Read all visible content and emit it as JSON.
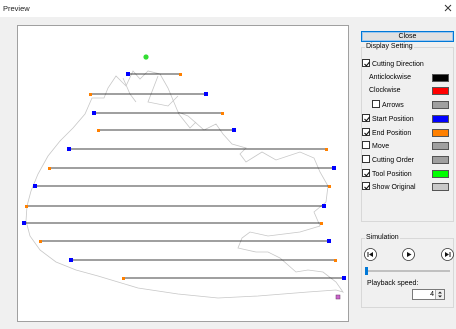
{
  "window": {
    "title": "Preview"
  },
  "panel": {
    "close_label": "Close",
    "display_setting": {
      "title": "Display Setting",
      "items": [
        {
          "label": "Cutting Direction",
          "checked": true,
          "has_checkbox": true,
          "indent": false,
          "color": null
        },
        {
          "label": "Anticlockwise",
          "has_checkbox": false,
          "indent": true,
          "color": "#000000"
        },
        {
          "label": "Clockwise",
          "has_checkbox": false,
          "indent": true,
          "color": "#ff0000"
        },
        {
          "label": "Arrows",
          "checked": false,
          "has_checkbox": true,
          "indent": true,
          "color": "#a0a0a0"
        },
        {
          "label": "Start Position",
          "checked": true,
          "has_checkbox": true,
          "indent": false,
          "color": "#0000ff"
        },
        {
          "label": "End Position",
          "checked": true,
          "has_checkbox": true,
          "indent": false,
          "color": "#ff8000"
        },
        {
          "label": "Move",
          "checked": false,
          "has_checkbox": true,
          "indent": false,
          "color": "#a0a0a0"
        },
        {
          "label": "Cutting Order",
          "checked": false,
          "has_checkbox": true,
          "indent": false,
          "color": "#a0a0a0"
        },
        {
          "label": "Tool Position",
          "checked": true,
          "has_checkbox": true,
          "indent": false,
          "color": "#00ff00"
        },
        {
          "label": "Show Original",
          "checked": true,
          "has_checkbox": true,
          "indent": false,
          "color": "#c8c8c8"
        }
      ]
    },
    "simulation": {
      "title": "Simulation",
      "playback_label": "Playback speed:",
      "playback_speed": "4",
      "slider_position": 0.0
    }
  }
}
